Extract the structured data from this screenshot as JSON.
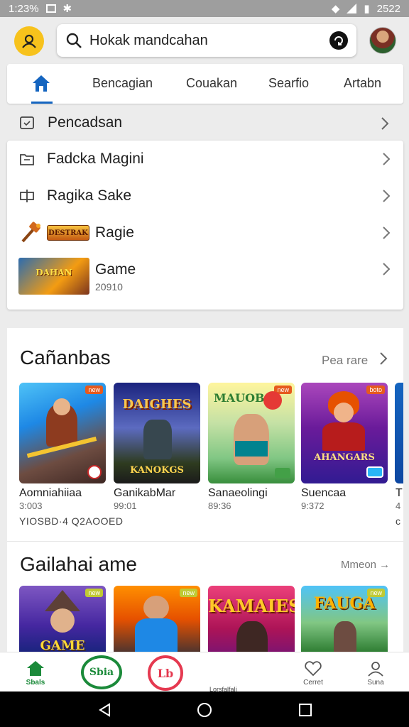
{
  "status_bar": {
    "time": "1:23%",
    "right_text": "2522"
  },
  "search": {
    "placeholder": "Hokak mandcahan"
  },
  "tabs": [
    {
      "label": "Bencagian"
    },
    {
      "label": "Couakan"
    },
    {
      "label": "Searfio"
    },
    {
      "label": "Artabn"
    }
  ],
  "menu": {
    "header": "Pencadsan",
    "items": [
      {
        "label": "Fadcka Magini",
        "sub": ""
      },
      {
        "label": "Ragika Sake",
        "sub": ""
      },
      {
        "label": "Ragie",
        "sub": "",
        "thumb_text": "DESTRAK"
      },
      {
        "label": "Game",
        "sub": "20910",
        "thumb_text": "DAHAN"
      }
    ]
  },
  "section1": {
    "title": "Cañanbas",
    "more": "Pea rare",
    "footer": "YIOSBD·4 Q2AOOED",
    "games": [
      {
        "name": "Aomniahiiaa",
        "sub": "3:003",
        "badge": "new",
        "art_text": "",
        "bottom": ""
      },
      {
        "name": "GanikabMar",
        "sub": "99:01",
        "badge": "",
        "art_text": "DAIGHES",
        "bottom": "KANOKGS"
      },
      {
        "name": "Sanaeolingi",
        "sub": "89:36",
        "badge": "new",
        "art_text": "MAUOB",
        "bottom": ""
      },
      {
        "name": "Suencaa",
        "sub": "9:372",
        "badge": "boto",
        "art_text": "AHANGARS",
        "bottom": ""
      },
      {
        "name": "T",
        "sub": "4",
        "badge": "",
        "art_text": "",
        "bottom": ""
      }
    ]
  },
  "section2": {
    "title": "Gailahai ame",
    "more": "Mmeon →",
    "games": [
      {
        "art_text": "GAME",
        "badge": "new"
      },
      {
        "art_text": "",
        "badge": "new"
      },
      {
        "art_text": "KAMAIES",
        "badge": ""
      },
      {
        "art_text": "FAUGA",
        "badge": "new"
      }
    ]
  },
  "bottom_nav": {
    "home": "Sbals",
    "logo_a": "Sbia",
    "logo_b": "Lb",
    "partial_text": "Lorsfalfali",
    "center": "Cerret",
    "right": "Suna"
  },
  "colors": {
    "accent": "#1565c0",
    "profile": "#f7c21c",
    "home_green": "#1b8a3a"
  }
}
